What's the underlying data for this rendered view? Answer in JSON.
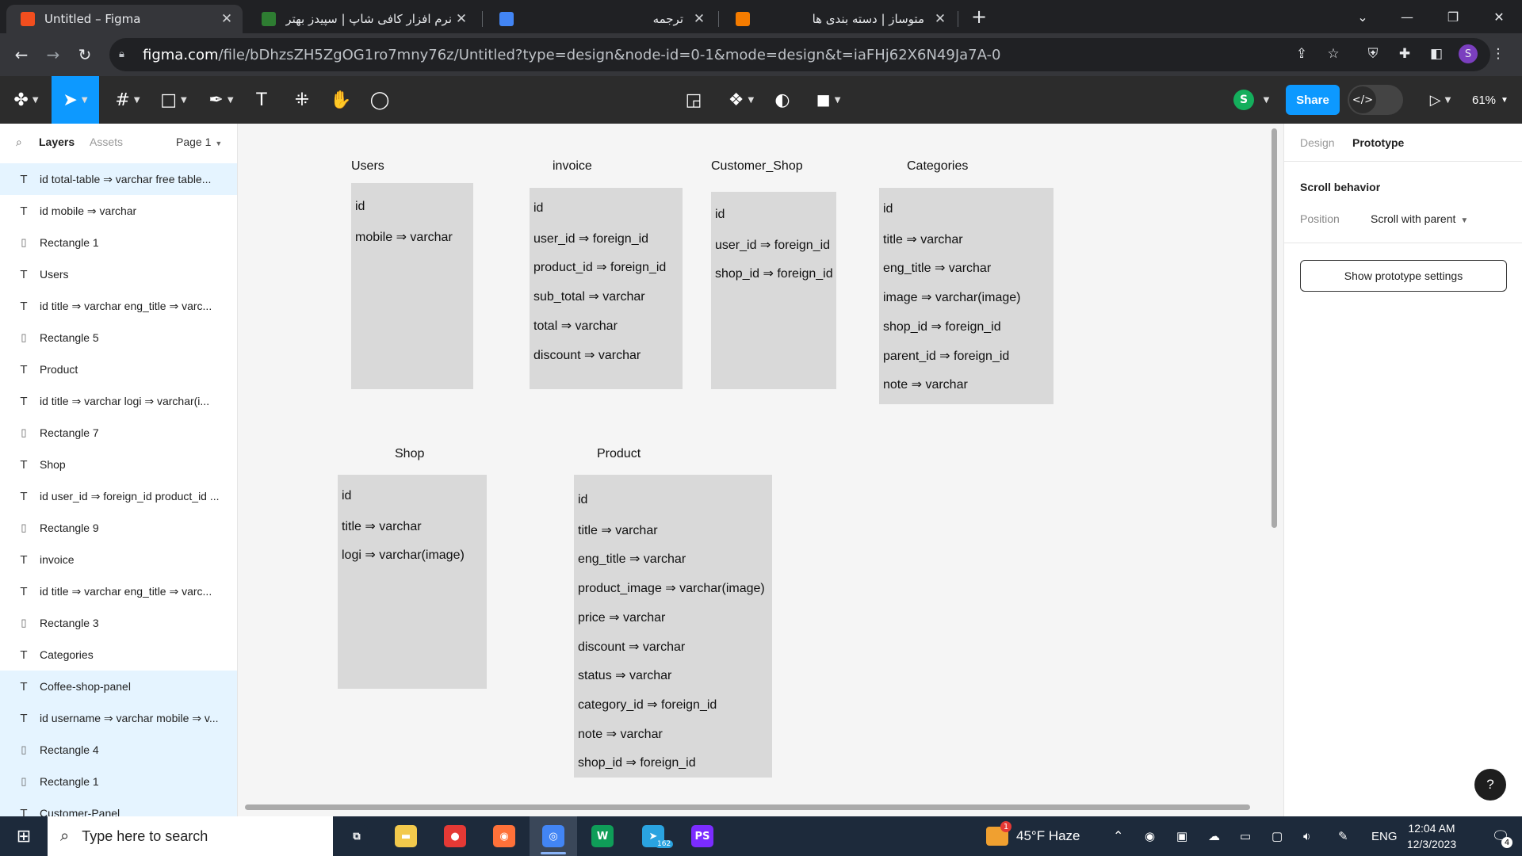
{
  "browser": {
    "tabs": [
      {
        "title": "Untitled – Figma",
        "icon": "figma-icon",
        "color": "#f24e1e"
      },
      {
        "title": "نرم افزار کافی شاپ | سپیدز بهترین",
        "icon": "site-icon",
        "color": "#2e7d32"
      },
      {
        "title": "ترجمه",
        "icon": "google-translate-icon",
        "color": "#4285f4"
      },
      {
        "title": "متوساز | دسته بندی ها",
        "icon": "site-menu-icon",
        "color": "#f57c00"
      }
    ],
    "url_host": "figma.com",
    "url_rest": "/file/bDhzsZH5ZgOG1ro7mny76z/Untitled?type=design&node-id=0-1&mode=design&t=iaFHj62X6N49Ja7A-0",
    "profile_initial": "S"
  },
  "toolbar": {
    "share_label": "Share",
    "zoom_label": "61%",
    "user_initial": "S",
    "accent": "#0d99ff"
  },
  "left_panel": {
    "tab_layers": "Layers",
    "tab_assets": "Assets",
    "page_label": "Page 1",
    "layers": [
      {
        "type": "text",
        "name": "id total-table ⇒ varchar free table...",
        "selected": true
      },
      {
        "type": "text",
        "name": "id mobile ⇒ varchar",
        "selected": false
      },
      {
        "type": "rect",
        "name": "Rectangle 1",
        "selected": false
      },
      {
        "type": "text",
        "name": "Users",
        "selected": false
      },
      {
        "type": "text",
        "name": "id title ⇒ varchar eng_title ⇒ varc...",
        "selected": false
      },
      {
        "type": "rect",
        "name": "Rectangle 5",
        "selected": false
      },
      {
        "type": "text",
        "name": "Product",
        "selected": false
      },
      {
        "type": "text",
        "name": "id title ⇒ varchar logi ⇒ varchar(i...",
        "selected": false
      },
      {
        "type": "rect",
        "name": "Rectangle 7",
        "selected": false
      },
      {
        "type": "text",
        "name": "Shop",
        "selected": false
      },
      {
        "type": "text",
        "name": "id user_id ⇒ foreign_id product_id ...",
        "selected": false
      },
      {
        "type": "rect",
        "name": "Rectangle 9",
        "selected": false
      },
      {
        "type": "text",
        "name": "invoice",
        "selected": false
      },
      {
        "type": "text",
        "name": "id title ⇒ varchar eng_title ⇒ varc...",
        "selected": false
      },
      {
        "type": "rect",
        "name": "Rectangle 3",
        "selected": false
      },
      {
        "type": "text",
        "name": "Categories",
        "selected": false
      },
      {
        "type": "text",
        "name": "Coffee-shop-panel",
        "selected": true
      },
      {
        "type": "text",
        "name": "id username ⇒ varchar mobile ⇒ v...",
        "selected": true
      },
      {
        "type": "rect",
        "name": "Rectangle 4",
        "selected": true
      },
      {
        "type": "rect",
        "name": "Rectangle 1",
        "selected": true
      },
      {
        "type": "text",
        "name": "Customer-Panel",
        "selected": true
      }
    ]
  },
  "canvas": {
    "tables": [
      {
        "name": "Users",
        "fields": [
          "id",
          "mobile  ⇒ varchar"
        ]
      },
      {
        "name": "invoice",
        "fields": [
          "id",
          "user_id  ⇒ foreign_id",
          "product_id  ⇒ foreign_id",
          "sub_total  ⇒ varchar",
          "total  ⇒ varchar",
          "discount  ⇒ varchar"
        ]
      },
      {
        "name": "Customer_Shop",
        "fields": [
          "id",
          "user_id  ⇒ foreign_id",
          "shop_id  ⇒ foreign_id"
        ]
      },
      {
        "name": "Categories",
        "fields": [
          "id",
          "title  ⇒ varchar",
          "eng_title  ⇒ varchar",
          "image ⇒  varchar(image)",
          "shop_id  ⇒ foreign_id",
          "parent_id  ⇒ foreign_id",
          "note  ⇒ varchar"
        ]
      },
      {
        "name": "Shop",
        "fields": [
          "id",
          "title ⇒ varchar",
          "logi ⇒ varchar(image)"
        ]
      },
      {
        "name": "Product",
        "fields": [
          "id",
          "title  ⇒ varchar",
          "eng_title  ⇒ varchar",
          "product_image ⇒ varchar(image)",
          "price  ⇒ varchar",
          "discount  ⇒ varchar",
          "status  ⇒ varchar",
          "category_id  ⇒ foreign_id",
          "note  ⇒ varchar",
          "shop_id ⇒ foreign_id"
        ]
      }
    ]
  },
  "right_panel": {
    "tab_design": "Design",
    "tab_prototype": "Prototype",
    "scroll_behavior": "Scroll behavior",
    "position_label": "Position",
    "position_value": "Scroll with parent",
    "settings_button": "Show prototype settings",
    "help": "?"
  },
  "taskbar": {
    "search_placeholder": "Type here to search",
    "telegram_badge": "162",
    "weather_text": "45°F  Haze",
    "weather_badge": "1",
    "language": "ENG",
    "time": "12:04 AM",
    "date": "12/3/2023",
    "notification_count": "4",
    "apps": [
      {
        "name": "task-view",
        "label": "⧉",
        "color": "#1d2a3b"
      },
      {
        "name": "file-explorer",
        "label": "▬",
        "color": "#f2c94c"
      },
      {
        "name": "screen-recorder",
        "label": "●",
        "color": "#e53935"
      },
      {
        "name": "firefox",
        "label": "◉",
        "color": "#ff7139"
      },
      {
        "name": "chrome",
        "label": "◎",
        "color": "#4285f4"
      },
      {
        "name": "webstorm",
        "label": "W",
        "color": "#0f9d58"
      },
      {
        "name": "telegram",
        "label": "➤",
        "color": "#2aa3e0"
      },
      {
        "name": "phpstorm",
        "label": "PS",
        "color": "#7b2cff"
      }
    ]
  }
}
